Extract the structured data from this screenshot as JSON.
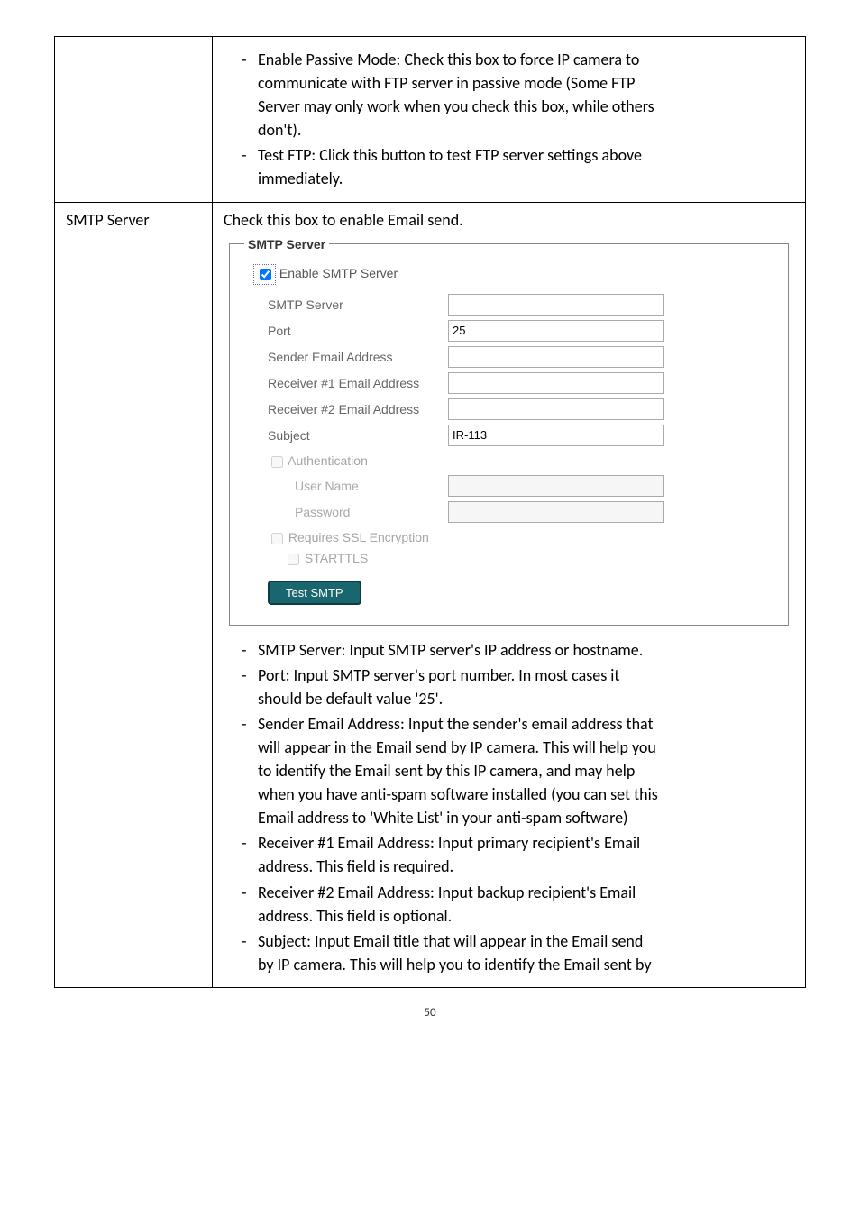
{
  "row0": {
    "bullet1_a": "Enable Passive Mode: Check this box to force IP camera to",
    "bullet1_b": "communicate with FTP server in passive mode (Some FTP",
    "bullet1_c": "Server may only work when you check this box, while others",
    "bullet1_d": "don't).",
    "bullet2_a": "Test FTP: Click this button to test FTP server settings above",
    "bullet2_b": "immediately."
  },
  "row1": {
    "left": "SMTP Server",
    "intro": "Check this box to enable Email send.",
    "smtp": {
      "legend": "SMTP Server",
      "enable_label": "Enable SMTP Server",
      "server_label": "SMTP Server",
      "server_value": "",
      "port_label": "Port",
      "port_value": "25",
      "sender_label": "Sender Email Address",
      "sender_value": "",
      "recv1_label": "Receiver #1 Email Address",
      "recv1_value": "",
      "recv2_label": "Receiver #2 Email Address",
      "recv2_value": "",
      "subject_label": "Subject",
      "subject_value": "IR-113",
      "auth_label": "Authentication",
      "user_label": "User Name",
      "user_value": "",
      "pass_label": "Password",
      "pass_value": "",
      "ssl_label": "Requires SSL Encryption",
      "starttls_label": "STARTTLS",
      "test_btn": "Test SMTP"
    },
    "bul1": "SMTP Server: Input SMTP server's IP address or hostname.",
    "bul2a": "Port: Input SMTP server's port number. In most cases it",
    "bul2b": "should be default value '25'.",
    "bul3a": "Sender Email Address: Input the sender's email address that",
    "bul3b": "will appear in the Email send by IP camera. This will help you",
    "bul3c": "to identify the Email sent by this IP camera, and may help",
    "bul3d": "when you have anti-spam software installed (you can set this",
    "bul3e": "Email address to 'White List' in your anti-spam software)",
    "bul4a": "Receiver #1 Email Address: Input primary recipient's Email",
    "bul4b": "address. This field is required.",
    "bul5a": "Receiver #2 Email Address: Input backup recipient's Email",
    "bul5b": "address. This field is optional.",
    "bul6a": "Subject: Input Email title that will appear in the Email send",
    "bul6b": "by IP camera. This will help you to identify the Email sent by"
  },
  "page": "50"
}
